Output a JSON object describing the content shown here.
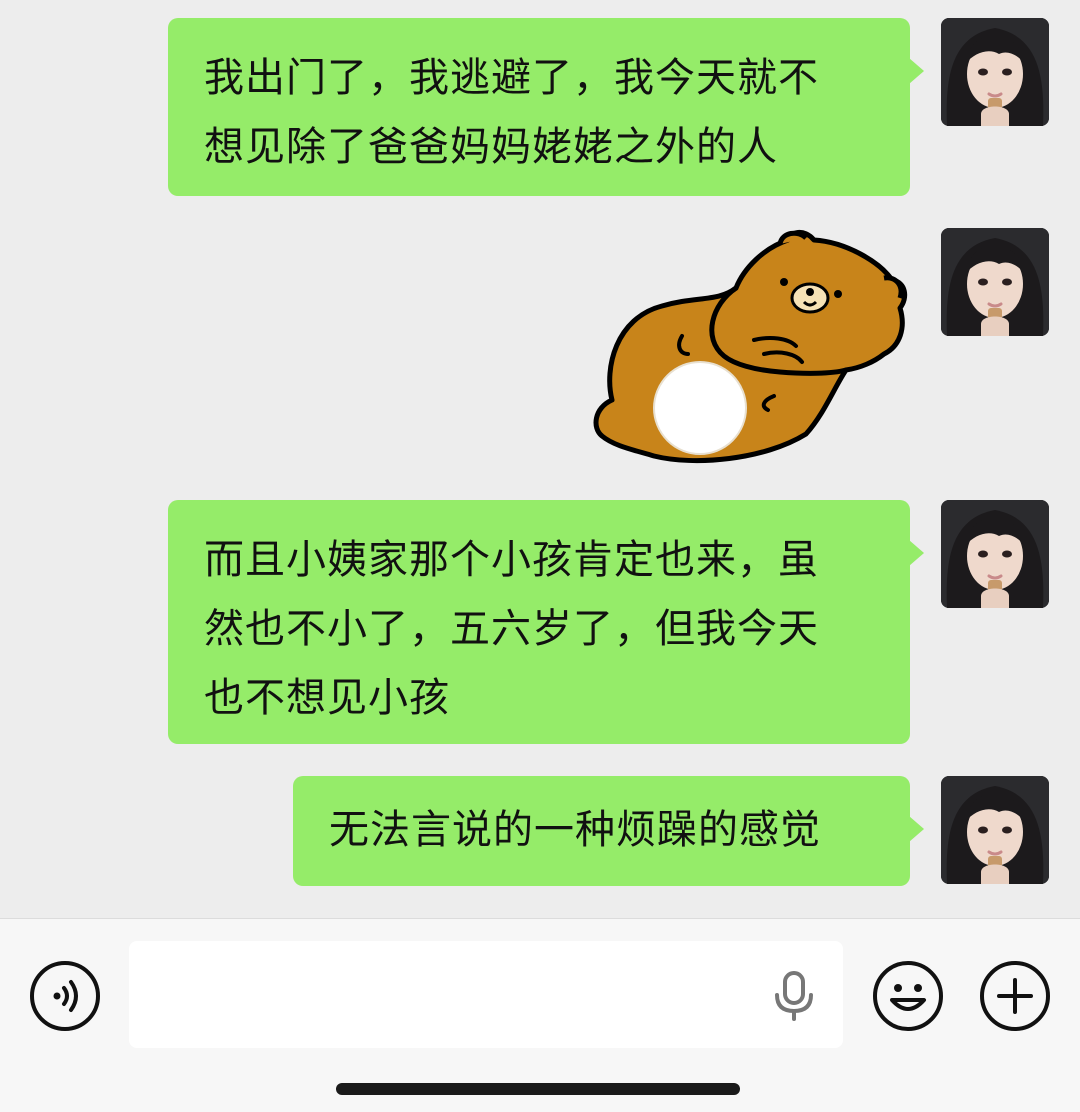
{
  "messages": [
    {
      "type": "text",
      "text": "我出门了，我逃避了，我今天就不想见除了爸爸妈妈姥姥之外的人",
      "lines": [
        "我出门了，我逃避了，我今天就不",
        "想见除了爸爸妈妈姥姥之外的人"
      ]
    },
    {
      "type": "sticker",
      "sticker": "brown-bear-lying-sticker"
    },
    {
      "type": "text",
      "text": "而且小姨家那个小孩肯定也来，虽然也不小了，五六岁了，但我今天也不想见小孩",
      "lines": [
        "而且小姨家那个小孩肯定也来，虽",
        "然也不小了，五六岁了，但我今天",
        "也不想见小孩"
      ]
    },
    {
      "type": "text",
      "text": "无法言说的一种烦躁的感觉",
      "lines": [
        "无法言说的一种烦躁的感觉"
      ]
    }
  ],
  "input": {
    "value": "",
    "placeholder": ""
  },
  "icons": {
    "voice": "voice-mode-icon",
    "mic": "microphone-icon",
    "emoji": "emoji-icon",
    "plus": "plus-icon"
  },
  "colors": {
    "bubble": "#95ec69",
    "background": "#ededed",
    "sticker_bear": "#c8841a"
  }
}
